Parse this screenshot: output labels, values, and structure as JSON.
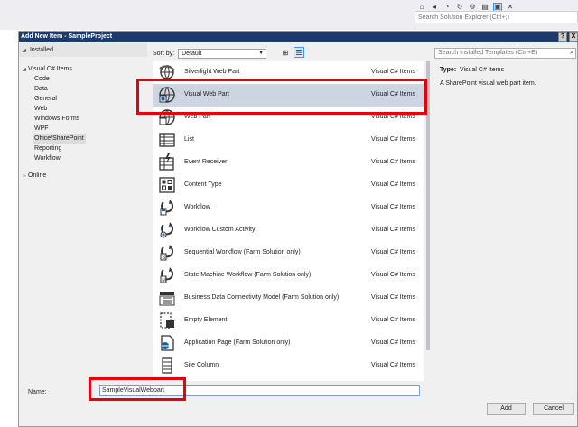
{
  "vs": {
    "toolbar_icons": [
      "home-icon",
      "back-icon",
      "history-icon",
      "refresh-icon",
      "settings-icon",
      "properties-icon",
      "show-all-icon",
      "close-icon"
    ],
    "search_placeholder": "Search Solution Explorer (Ctrl+;)"
  },
  "dialog": {
    "title": "Add New Item - SampleProject",
    "help_label": "?",
    "close_label": "X"
  },
  "tree": {
    "header": "Installed",
    "items": [
      {
        "label": "Visual C# Items",
        "level": 0,
        "expanded": true
      },
      {
        "label": "Code",
        "level": 1
      },
      {
        "label": "Data",
        "level": 1
      },
      {
        "label": "General",
        "level": 1
      },
      {
        "label": "Web",
        "level": 1
      },
      {
        "label": "Windows Forms",
        "level": 1
      },
      {
        "label": "WPF",
        "level": 1
      },
      {
        "label": "Office/SharePoint",
        "level": 1,
        "selected": true
      },
      {
        "label": "Reporting",
        "level": 1
      },
      {
        "label": "Workflow",
        "level": 1
      }
    ],
    "online": "Online"
  },
  "sort": {
    "label": "Sort by:",
    "value": "Default"
  },
  "template_search": {
    "placeholder": "Search Installed Templates (Ctrl+E)"
  },
  "templates": [
    {
      "name": "Silverlight Web Part",
      "category": "Visual C# Items",
      "icon": "silverlight-webpart-icon"
    },
    {
      "name": "Visual Web Part",
      "category": "Visual C# Items",
      "icon": "visual-webpart-icon",
      "selected": true
    },
    {
      "name": "Web Part",
      "category": "Visual C# Items",
      "icon": "webpart-icon"
    },
    {
      "name": "List",
      "category": "Visual C# Items",
      "icon": "list-icon"
    },
    {
      "name": "Event Receiver",
      "category": "Visual C# Items",
      "icon": "event-receiver-icon"
    },
    {
      "name": "Content Type",
      "category": "Visual C# Items",
      "icon": "content-type-icon"
    },
    {
      "name": "Workflow",
      "category": "Visual C# Items",
      "icon": "workflow-icon"
    },
    {
      "name": "Workflow Custom Activity",
      "category": "Visual C# Items",
      "icon": "workflow-activity-icon"
    },
    {
      "name": "Sequential Workflow (Farm Solution only)",
      "category": "Visual C# Items",
      "icon": "sequential-workflow-icon"
    },
    {
      "name": "State Machine Workflow (Farm Solution only)",
      "category": "Visual C# Items",
      "icon": "state-machine-workflow-icon"
    },
    {
      "name": "Business Data Connectivity Model (Farm Solution only)",
      "category": "Visual C# Items",
      "icon": "bdc-model-icon"
    },
    {
      "name": "Empty Element",
      "category": "Visual C# Items",
      "icon": "empty-element-icon"
    },
    {
      "name": "Application Page (Farm Solution only)",
      "category": "Visual C# Items",
      "icon": "application-page-icon"
    },
    {
      "name": "Site Column",
      "category": "Visual C# Items",
      "icon": "site-column-icon"
    }
  ],
  "details": {
    "type_label": "Type:",
    "type_value": "Visual C# Items",
    "description": "A SharePoint visual web part item."
  },
  "name_field": {
    "label": "Name:",
    "value": "SampleVisualWebpart"
  },
  "buttons": {
    "add": "Add",
    "cancel": "Cancel"
  },
  "colors": {
    "titlebar": "#1c3a6b",
    "selection": "#cdd4e2",
    "highlight": "#e8000d"
  }
}
